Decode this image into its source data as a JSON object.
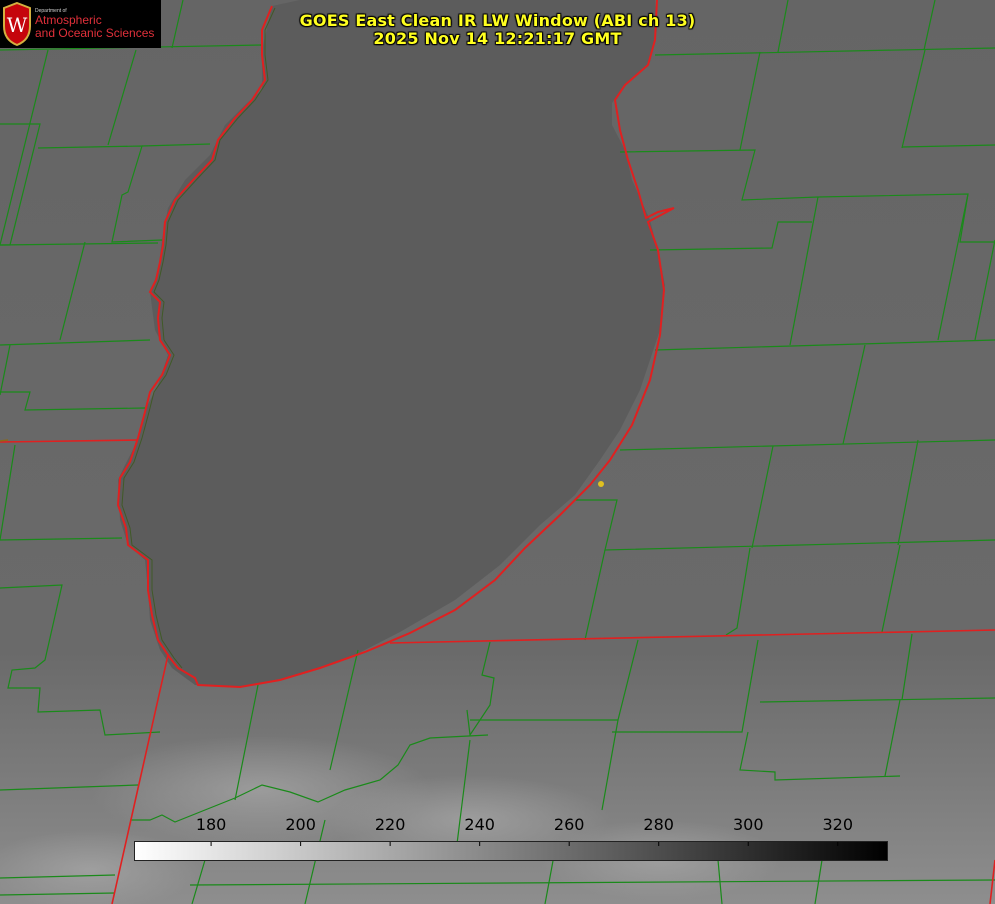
{
  "title": {
    "line1": "GOES East Clean IR LW Window (ABI ch 13)",
    "line2": "2025 Nov 14 12:21:17 GMT"
  },
  "logo": {
    "dept": "Department of",
    "line1": "Atmospheric",
    "line2": "and Oceanic Sciences",
    "crest_letter": "W"
  },
  "colorbar": {
    "ticks": [
      "180",
      "200",
      "220",
      "240",
      "260",
      "280",
      "300",
      "320"
    ],
    "tick_values": [
      180,
      200,
      220,
      240,
      260,
      280,
      300,
      320
    ],
    "min": 163,
    "max": 331,
    "gradient": [
      "#ffffff",
      "#000000"
    ]
  },
  "colors": {
    "county_lines": "#1a8a1a",
    "state_and_coast": "#e02020",
    "marker": "#e0c020",
    "title": "#ffff1f"
  }
}
